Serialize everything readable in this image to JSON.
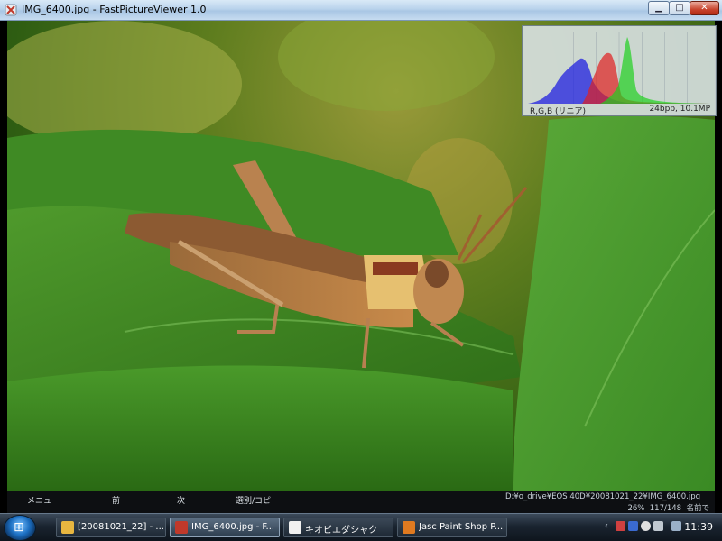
{
  "window": {
    "title": "IMG_6400.jpg - FastPictureViewer 1.0",
    "min_glyph": "▁",
    "max_glyph": "□",
    "close_glyph": "✕"
  },
  "histogram": {
    "mode_label": "R,G,B (リニア)",
    "info_label": "24bpp, 10.1MP",
    "colors": {
      "red": "#e02020",
      "green": "#20d020",
      "blue": "#2020e0"
    }
  },
  "bottom_bar": {
    "menu_items": [
      "メニュー",
      "前",
      "次",
      "選別/コピー"
    ],
    "path": "D:¥o_drive¥EOS 40D¥20081021_22¥IMG_6400.jpg",
    "zoom": "26%",
    "position": "117/148",
    "sort": "名前で"
  },
  "taskbar": {
    "start_glyph": "⊞",
    "buttons": [
      {
        "label": "[20081021_22] - ...",
        "icon_color": "#e8b640",
        "active": false
      },
      {
        "label": "IMG_6400.jpg - F...",
        "icon_color": "#c0392b",
        "active": true
      },
      {
        "label": "キオビエダシャク",
        "icon_color": "#f0f0f0",
        "active": false
      },
      {
        "label": "Jasc Paint Shop P...",
        "icon_color": "#e07a20",
        "active": false
      }
    ],
    "tray_arrow": "‹",
    "clock": "11:39"
  }
}
